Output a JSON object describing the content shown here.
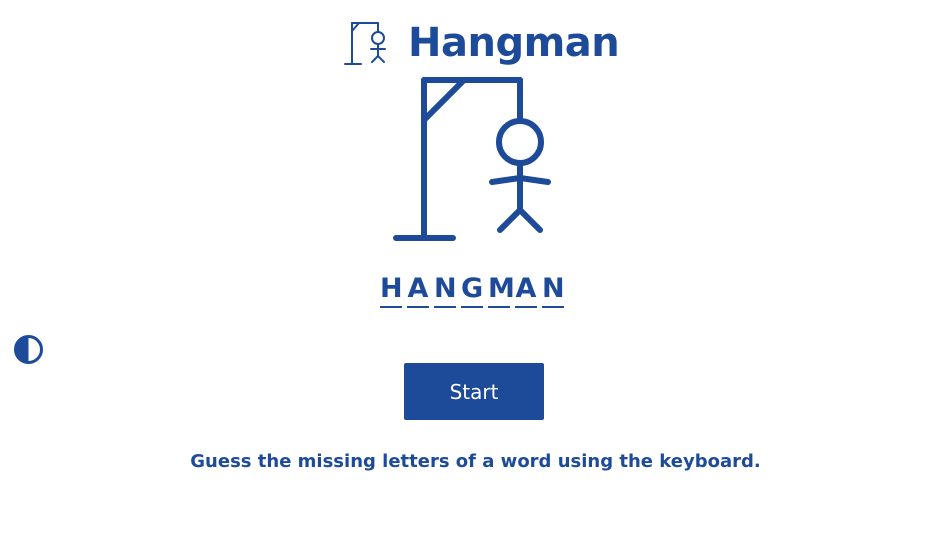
{
  "app": {
    "title": "Hangman",
    "logo_icon": "hangman-logo-icon",
    "accent_color": "#1d4b9a",
    "background_color": "#ffffff"
  },
  "game": {
    "word_letters": [
      "H",
      "A",
      "N",
      "G",
      "M",
      "A",
      "N"
    ],
    "illustration": "gallows-with-stick-figure"
  },
  "controls": {
    "theme_toggle_icon": "contrast-icon",
    "start_label": "Start"
  },
  "instructions": "Guess the missing letters of a word using the keyboard."
}
